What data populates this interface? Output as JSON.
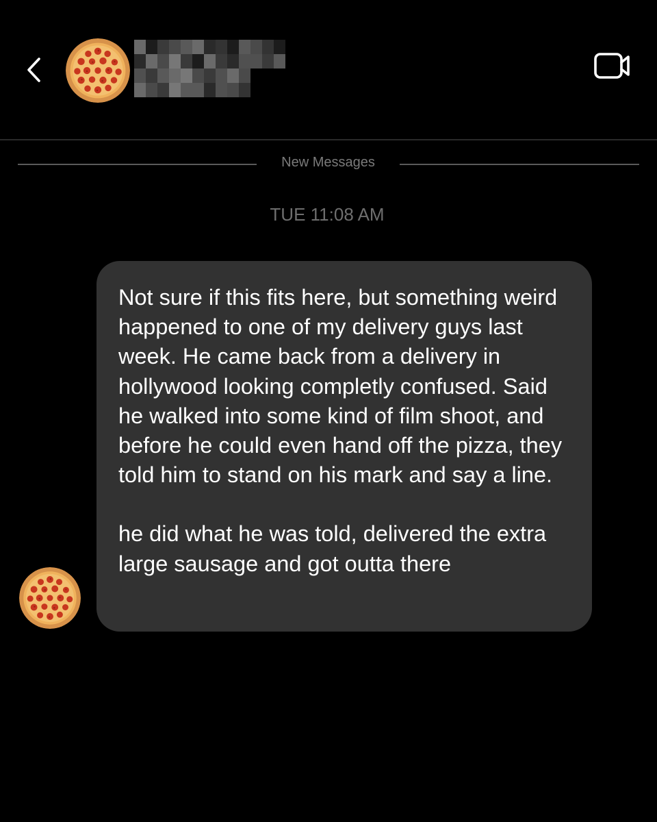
{
  "header": {
    "back_icon": "chevron-left-icon",
    "avatar_icon": "pizza-icon",
    "contact_name_redacted": true,
    "video_icon": "video-camera-icon"
  },
  "divider": {
    "label": "New Messages"
  },
  "thread": {
    "timestamp": "TUE 11:08 AM",
    "messages": [
      {
        "sender_avatar_icon": "pizza-icon",
        "paragraphs": [
          "Not sure if this fits here, but something weird happened to one of my delivery guys last week. He came back from a delivery in hollywood looking completly confused. Said he walked into some kind of film shoot, and before he could even hand off the pizza, they told him to stand on his mark and say a line.",
          "he did what he was told, delivered the extra large sausage and got outta there"
        ]
      }
    ]
  },
  "colors": {
    "background": "#000000",
    "bubble": "#323232",
    "text": "#ffffff",
    "muted_text": "#6e6e6e",
    "divider": "#5a5a5a"
  }
}
